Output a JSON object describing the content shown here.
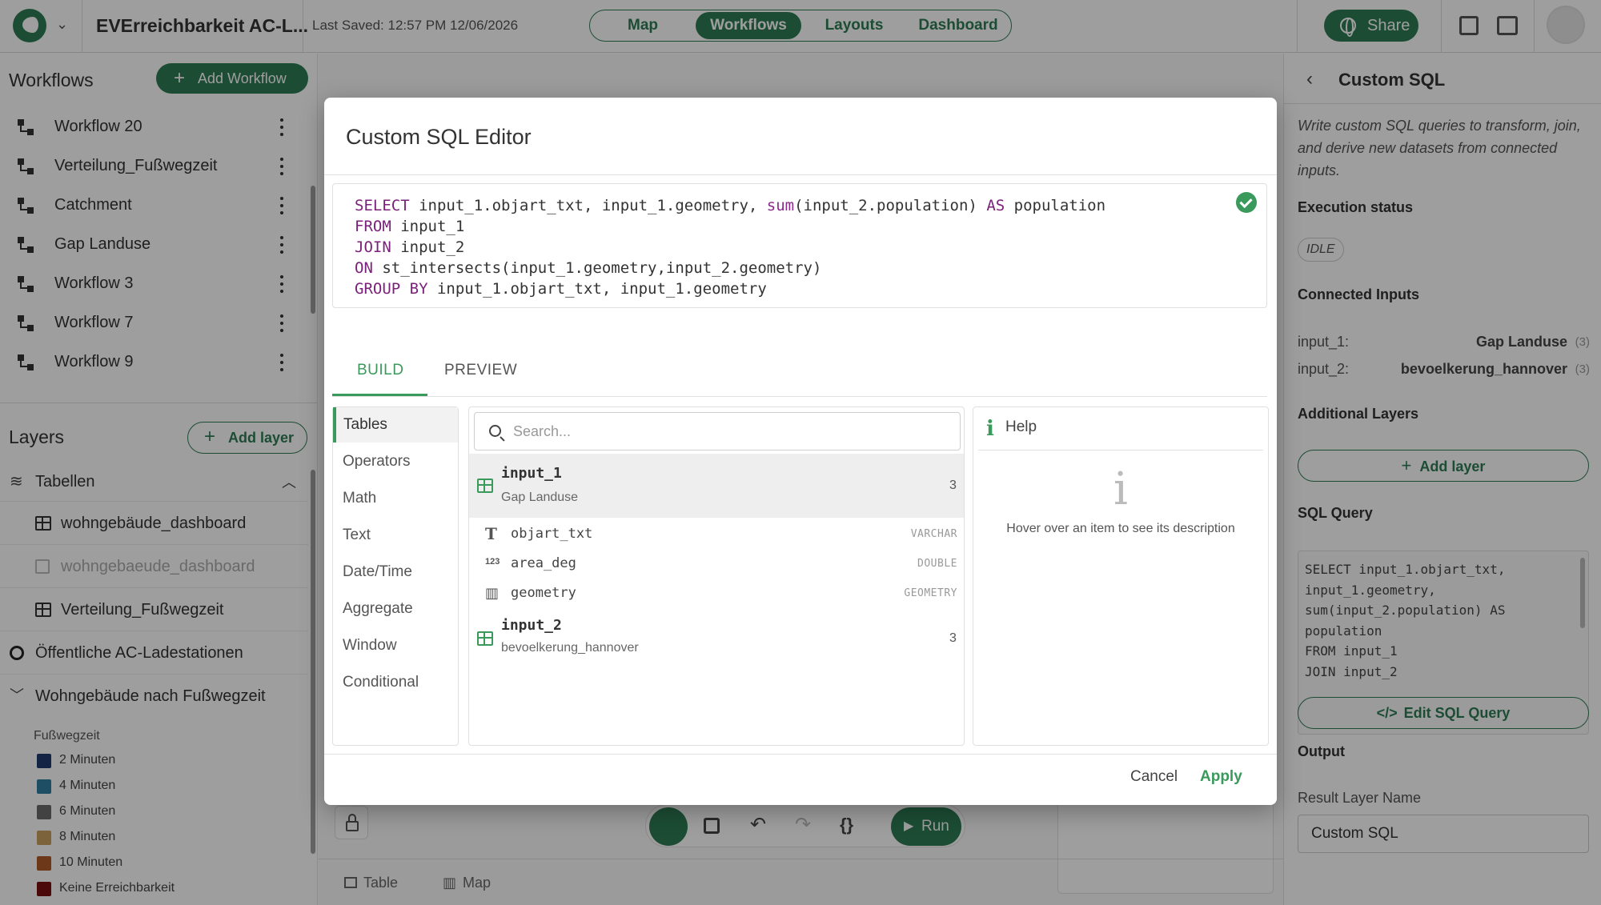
{
  "topbar": {
    "project_title": "EVErreichbarkeit AC-L...",
    "last_saved": "Last Saved: 12:57 PM 12/06/2026",
    "nav_tabs": [
      "Map",
      "Workflows",
      "Layouts",
      "Dashboard"
    ],
    "active_tab": "Workflows",
    "share_label": "Share"
  },
  "workflows": {
    "title": "Workflows",
    "add_label": "Add Workflow",
    "items": [
      "Workflow 20",
      "Verteilung_Fußwegzeit",
      "Catchment",
      "Gap Landuse",
      "Workflow 3",
      "Workflow 7",
      "Workflow 9"
    ]
  },
  "layers": {
    "title": "Layers",
    "add_label": "Add layer",
    "group_label": "Tabellen",
    "table_layers": [
      "wohngebäude_dashboard",
      "wohngebaeude_dashboard",
      "Verteilung_Fußwegzeit"
    ],
    "layer_point": "Öffentliche AC-Ladestationen",
    "layer_expanded": "Wohngebäude nach Fußwegzeit",
    "legend_title": "Fußwegzeit",
    "legend": [
      {
        "label": "2 Minuten",
        "color": "#1f3a6e"
      },
      {
        "label": "4 Minuten",
        "color": "#2f7fa0"
      },
      {
        "label": "6 Minuten",
        "color": "#6b6b6b"
      },
      {
        "label": "8 Minuten",
        "color": "#c8a060"
      },
      {
        "label": "10 Minuten",
        "color": "#b05a2a"
      },
      {
        "label": "Keine Erreichbarkeit",
        "color": "#7a1010"
      }
    ]
  },
  "canvas": {
    "run_label": "Run",
    "bottom_tabs": [
      "Table",
      "Map"
    ]
  },
  "right_panel": {
    "title": "Custom SQL",
    "description": "Write custom SQL queries to transform, join, and derive new datasets from connected inputs.",
    "exec_status_label": "Execution status",
    "exec_status": "IDLE",
    "connected_inputs_label": "Connected Inputs",
    "inputs": [
      {
        "key": "input_1:",
        "value": "Gap Landuse",
        "count": "(3)"
      },
      {
        "key": "input_2:",
        "value": "bevoelkerung_hannover",
        "count": "(3)"
      }
    ],
    "additional_layers_label": "Additional Layers",
    "add_layer_label": "Add layer",
    "sql_query_label": "SQL Query",
    "sql_preview": [
      "SELECT input_1.objart_txt,",
      "input_1.geometry,",
      "sum(input_2.population) AS",
      "population",
      "FROM input_1",
      "JOIN input_2"
    ],
    "edit_sql_label": "Edit SQL Query",
    "output_label": "Output",
    "result_name_label": "Result Layer Name",
    "result_name_value": "Custom SQL"
  },
  "modal": {
    "title": "Custom SQL Editor",
    "sql_lines": [
      [
        {
          "t": "SELECT",
          "c": "kw"
        },
        {
          "t": " input_1.objart_txt, input_1.geometry, "
        },
        {
          "t": "sum",
          "c": "fn"
        },
        {
          "t": "(input_2.population) "
        },
        {
          "t": "AS",
          "c": "kw"
        },
        {
          "t": " population"
        }
      ],
      [
        {
          "t": "FROM",
          "c": "kw"
        },
        {
          "t": " input_1"
        }
      ],
      [
        {
          "t": "JOIN",
          "c": "kw"
        },
        {
          "t": " input_2"
        }
      ],
      [
        {
          "t": "ON",
          "c": "kw"
        },
        {
          "t": " st_intersects(input_1.geometry,input_2.geometry)"
        }
      ],
      [
        {
          "t": "GROUP BY",
          "c": "kw"
        },
        {
          "t": " input_1.objart_txt, input_1.geometry"
        }
      ]
    ],
    "tabs": {
      "build": "BUILD",
      "preview": "PREVIEW"
    },
    "categories": [
      "Tables",
      "Operators",
      "Math",
      "Text",
      "Date/Time",
      "Aggregate",
      "Window",
      "Conditional"
    ],
    "active_category": "Tables",
    "search_placeholder": "Search...",
    "tables": [
      {
        "name": "input_1",
        "source": "Gap Landuse",
        "count": "3",
        "columns": [
          {
            "icon": "T",
            "name": "objart_txt",
            "type": "VARCHAR"
          },
          {
            "icon": "123",
            "name": "area_deg",
            "type": "DOUBLE"
          },
          {
            "icon": "map",
            "name": "geometry",
            "type": "GEOMETRY"
          }
        ]
      },
      {
        "name": "input_2",
        "source": "bevoelkerung_hannover",
        "count": "3",
        "columns": []
      }
    ],
    "help_title": "Help",
    "help_text": "Hover over an item to see its description",
    "cancel_label": "Cancel",
    "apply_label": "Apply"
  }
}
